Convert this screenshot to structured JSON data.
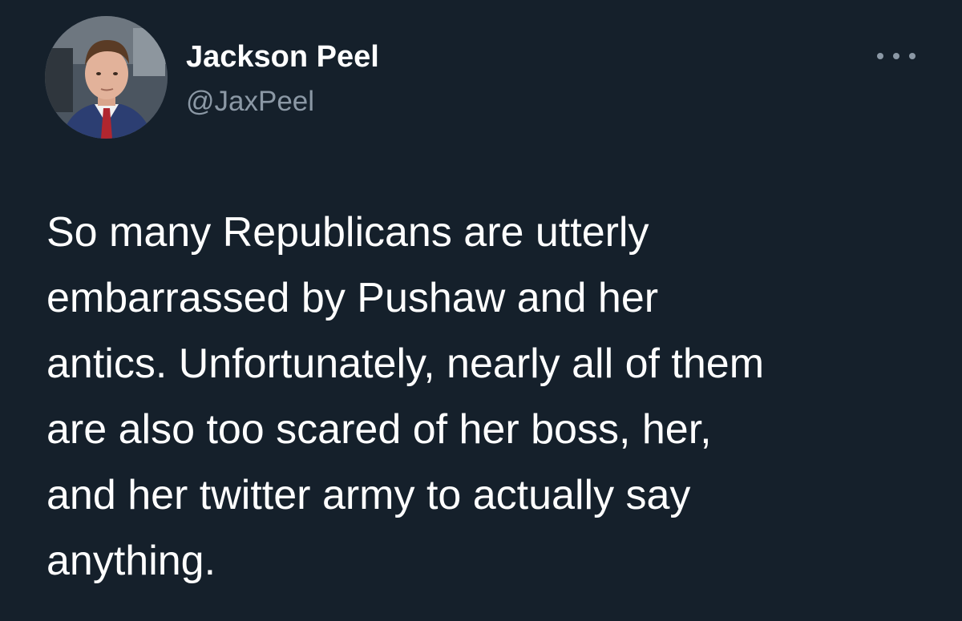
{
  "author": {
    "name": "Jackson Peel",
    "handle": "@JaxPeel"
  },
  "tweet": {
    "lines": [
      "So many Republicans are utterly",
      "embarrassed by Pushaw and her",
      "antics. Unfortunately, nearly all of them",
      "are also too scared of her boss, her,",
      "and her twitter army to actually say",
      "anything."
    ]
  },
  "icons": {
    "more": "more-horizontal-icon"
  },
  "colors": {
    "background": "#15202b",
    "text": "#ffffff",
    "secondary_text": "#8b98a5"
  }
}
